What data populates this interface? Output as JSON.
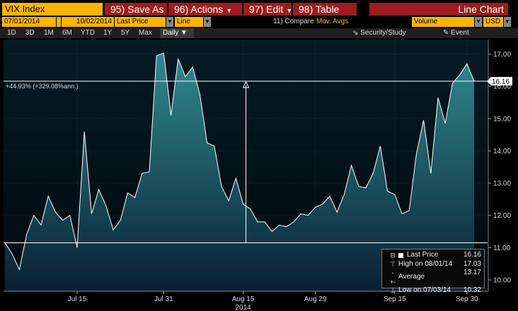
{
  "toolbar": {
    "ticker": "VIX Index",
    "save_as": "95) Save As",
    "actions": "96) Actions",
    "edit": "97) Edit",
    "table": "98) Table",
    "view_title": "Line Chart"
  },
  "fields": {
    "start_date": "07/01/2014",
    "end_date": "10/02/2014",
    "price_field": "Last Price",
    "chart_style": "Line",
    "compare": "11) Compare",
    "mov_avgs": "Mov. Avgs",
    "volume": "Volume",
    "currency": "USD"
  },
  "periods": [
    "1D",
    "3D",
    "1M",
    "6M",
    "YTD",
    "1Y",
    "5Y",
    "Max"
  ],
  "period_selected": "Daily",
  "tools": {
    "security_study": "Security/Study",
    "event": "Event"
  },
  "chart_data": {
    "type": "area",
    "series": [
      {
        "name": "Last Price",
        "values": [
          11.15,
          10.8,
          10.32,
          11.4,
          12.0,
          11.7,
          12.6,
          12.1,
          11.85,
          12.0,
          11.0,
          14.6,
          12.05,
          12.8,
          12.3,
          11.55,
          11.85,
          12.7,
          12.55,
          13.3,
          13.35,
          16.95,
          17.03,
          15.1,
          16.85,
          16.3,
          16.6,
          15.75,
          14.25,
          14.15,
          12.9,
          12.45,
          13.15,
          12.35,
          12.2,
          11.8,
          11.8,
          11.5,
          11.7,
          11.65,
          11.8,
          12.05,
          12.0,
          12.25,
          12.35,
          12.6,
          12.1,
          12.65,
          13.55,
          12.9,
          12.85,
          13.3,
          14.15,
          12.75,
          12.65,
          12.05,
          12.15,
          13.9,
          14.95,
          13.3,
          15.65,
          14.85,
          16.1,
          16.35,
          16.7,
          16.16
        ]
      }
    ],
    "x_tick_labels": [
      "Jul 15",
      "Jul 31",
      "Aug 15",
      "Aug 29",
      "Sep 15",
      "Sep 30"
    ],
    "x_tick_index": [
      10,
      22,
      33,
      43,
      54,
      64
    ],
    "x_year_label": "2014",
    "y_tick_labels": [
      "10.00",
      "11.00",
      "12.00",
      "13.00",
      "14.00",
      "15.00",
      "16.00",
      "17.00"
    ],
    "ylim": [
      9.65,
      17.45
    ],
    "current_value_label": "16.16",
    "reference_low": 11.15,
    "reference_high": 16.16,
    "change_annotation": "+44.93% (+329.08%ann.)",
    "grid": true,
    "colors": {
      "background": "#051520",
      "area_top": "#2f8a8e",
      "area_bottom": "#0a1f33",
      "line": "#ffffff"
    }
  },
  "legend": {
    "rows": [
      {
        "label": "Last Price",
        "value": "16.16"
      },
      {
        "label": "High on 08/01/14",
        "value": "17.03"
      },
      {
        "label": "Average",
        "value": "13.17"
      },
      {
        "label": "Low on 07/03/14",
        "value": "10.32"
      }
    ]
  },
  "colors": {
    "accent": "#ffb400",
    "tab": "#9b1d1f"
  }
}
